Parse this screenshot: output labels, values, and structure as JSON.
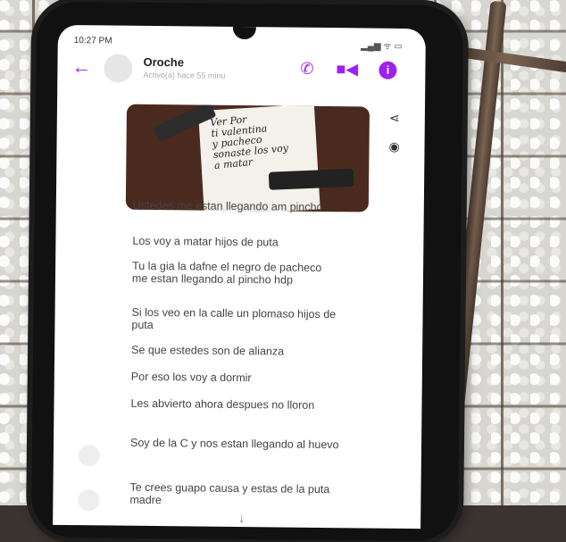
{
  "status_bar": {
    "time": "10:27 PM",
    "icons_left": "җ ⛓ ©"
  },
  "chat": {
    "contact_name": "Oroche",
    "active_status": "Activo(a) hace 55 minu"
  },
  "photo_note": [
    "Ver Por",
    "ti valentina",
    "y pacheco",
    "sonaste los voy",
    "a matar"
  ],
  "messages": [
    "Ustedes me estan llegando am pincho",
    "Los voy a matar hijos de puta",
    "Tu la gia la dafne el negro de pacheco me estan llegando al pincho hdp",
    "Si los veo en la calle un plomaso hijos de puta",
    "Se que estedes son de alianza",
    "Por eso los voy a dormir",
    "Les abvierto ahora despues no lloron",
    "Soy de la C y nos estan llegando al huevo",
    "Te crees guapo causa y estas de la puta madre"
  ],
  "icons": {
    "back": "arrow-left-icon",
    "call": "phone-icon",
    "video": "video-icon",
    "info": "info-icon",
    "share": "share-icon",
    "camera": "camera-icon",
    "scroll": "arrow-down-icon"
  },
  "colors": {
    "accent": "#a020f0"
  }
}
